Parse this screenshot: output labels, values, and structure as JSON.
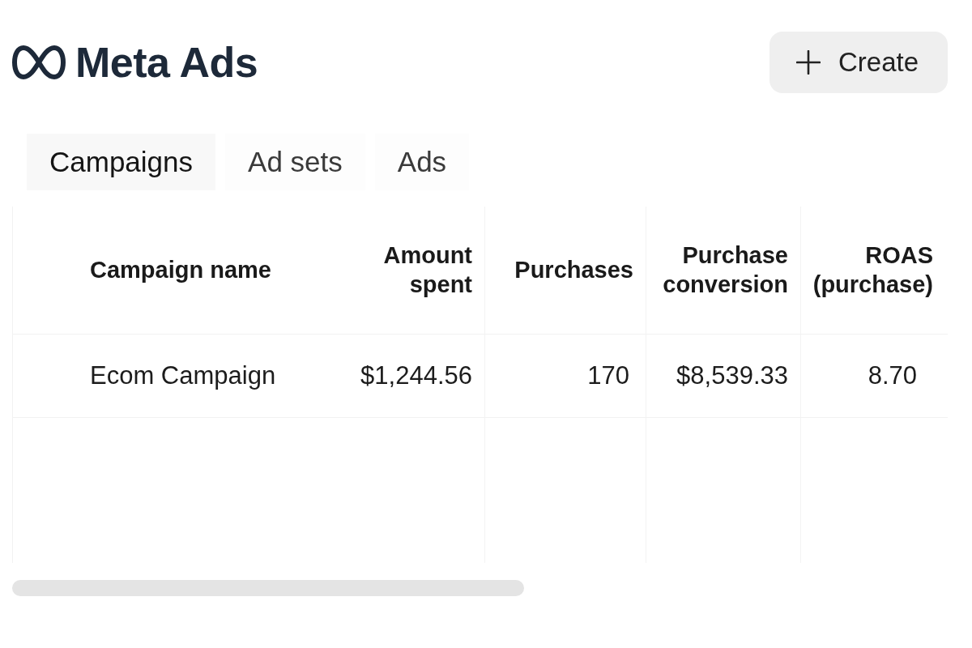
{
  "brand": {
    "name": "Meta Ads"
  },
  "create_button": {
    "label": "Create"
  },
  "tabs": [
    {
      "label": "Campaigns",
      "selected": true
    },
    {
      "label": "Ad sets",
      "selected": false
    },
    {
      "label": "Ads",
      "selected": false
    }
  ],
  "table": {
    "columns": [
      "Campaign name",
      "Amount spent",
      "Purchases",
      "Purchase conversion",
      "ROAS (purchase)"
    ],
    "rows": [
      {
        "cells": [
          "Ecom Campaign",
          "$1,244.56",
          "170",
          "$8,539.33",
          "8.70"
        ]
      }
    ]
  }
}
